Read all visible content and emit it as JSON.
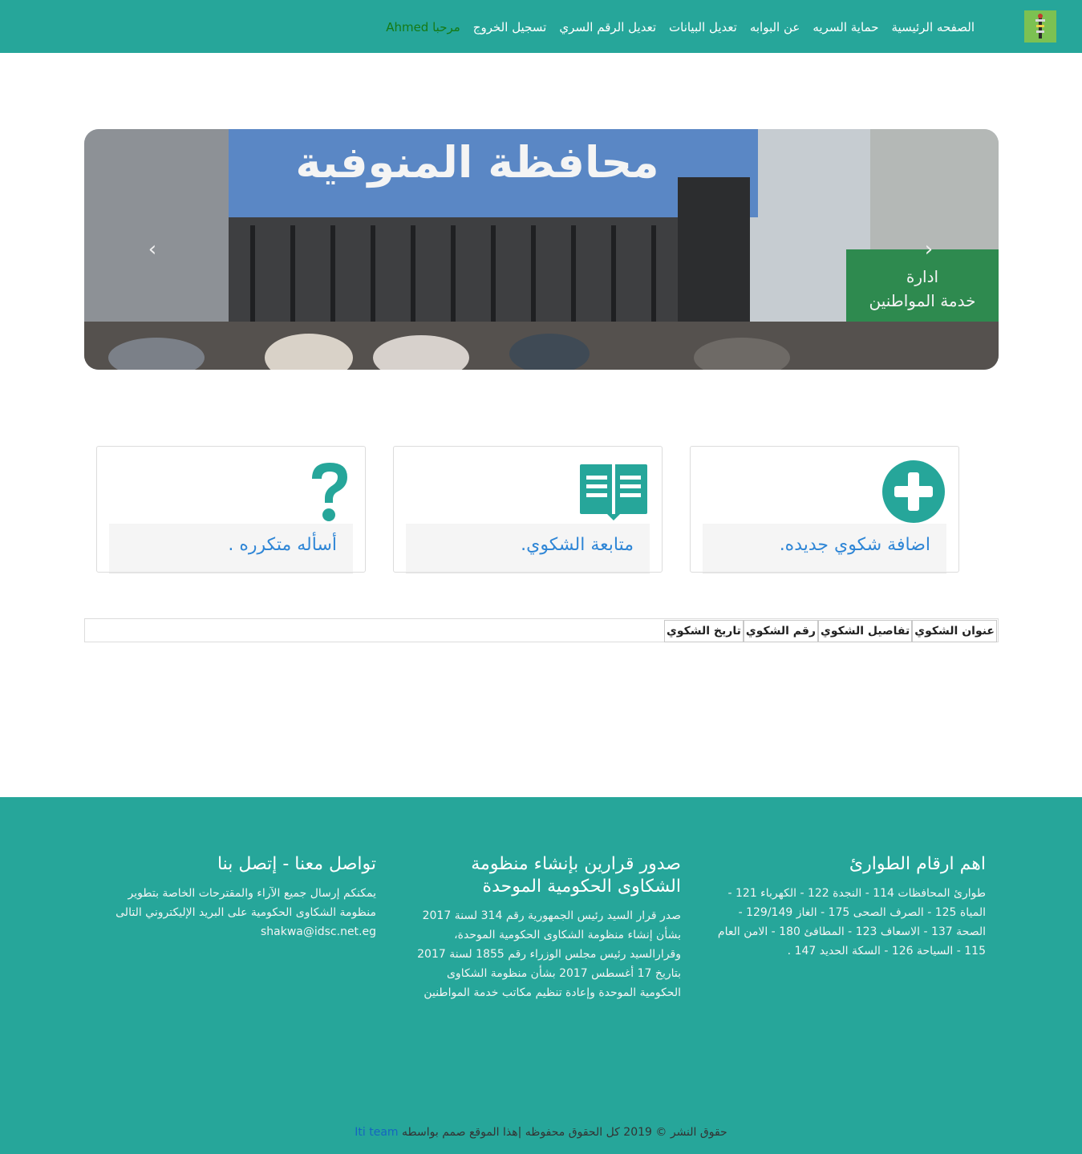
{
  "nav": {
    "items": [
      "الصفحه الرئيسية",
      "حماية السريه",
      "عن البوابه",
      "تعديل البيانات",
      "تعديل الرقم السري",
      "تسجيل الخروج"
    ],
    "welcome": "مرحبا Ahmed"
  },
  "carousel": {
    "sign_main": "محافظة المنوفية",
    "sign_small_1": "ادارة",
    "sign_small_2": "خدمة المواطنين",
    "prev": "‹",
    "next": "›"
  },
  "cards": [
    {
      "title": "اضافة شكوي جديده.",
      "icon": "plus-circle-icon"
    },
    {
      "title": "متابعة الشكوي.",
      "icon": "book-icon"
    },
    {
      "title": "أسأله متكرره .",
      "icon": "question-icon"
    }
  ],
  "table": {
    "headers": [
      "عنوان الشكوي",
      "تفاصيل الشكوي",
      "رقم الشكوي",
      "تاريخ الشكوي"
    ]
  },
  "footer": {
    "emergency": {
      "title": "اهم ارقام الطوارئ",
      "text": "طوارئ المحافظات 114 - النجدة 122 - الكهرباء 121 - المياة 125 - الصرف الصحى 175 - الغاز 129/149 - الصحة 137 - الاسعاف 123 - المطافئ 180 - الامن العام 115 - السياحة 126 - السكة الحديد 147 ."
    },
    "decrees": {
      "title": "صدور قرارين بإنشاء منظومة الشكاوى الحكومية الموحدة",
      "text": "صدر قرار السيد رئيس الجمهورية رقم 314 لسنة 2017 بشأن إنشاء منظومة الشكاوى الحكومية الموحدة، وقرارالسيد رئيس مجلس الوزراء رقم 1855 لسنة 2017 بتاريخ 17 أغسطس 2017 بشأن منظومة الشكاوى الحكومية الموحدة وإعادة تنظيم مكاتب خدمة المواطنين"
    },
    "contact": {
      "title": "تواصل معنا - إتصل بنا",
      "text": "يمكنكم إرسال جميع الآراء والمقترحات الخاصة بتطوير منظومة الشكاوى الحكومية على البريد الإليكتروني التالى shakwa@idsc.net.eg"
    },
    "copyright": "حقوق النشر © 2019 كل الحقوق محفوظه |هذا الموقع صمم بواسطه",
    "team": "Iti team"
  },
  "colors": {
    "primary": "#26a69a",
    "link": "#2f86d6",
    "welcome": "#157a15"
  }
}
